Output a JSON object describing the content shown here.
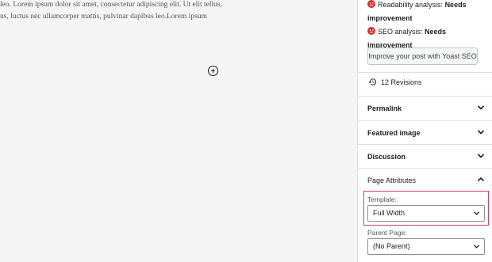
{
  "editor": {
    "paragraph_line_1": "leo. Lorem ipsum dolor sit amet, consectetur adipiscing elit. Ut elit tellus,",
    "paragraph_line_2": "us, luctus nec ullamcorper mattis, pulvinar dapibus leo.Lorem ipsum"
  },
  "sidebar": {
    "yoast": {
      "readability_label": "Readability analysis:",
      "readability_value_1": "Needs",
      "readability_value_2": "improvement",
      "seo_label": "SEO analysis:",
      "seo_value": "Needs improvement",
      "status_color": "#dc3232",
      "improve_button": "Improve your post with Yoast SEO"
    },
    "revisions": "12 Revisions",
    "panels": {
      "permalink": "Permalink",
      "featured_image": "Featured image",
      "discussion": "Discussion",
      "page_attributes": "Page Attributes"
    },
    "page_attributes": {
      "template_label": "Template:",
      "template_value": "Full Width",
      "parent_label": "Parent Page:",
      "parent_value": "(No Parent)"
    },
    "highlight_color": "#d63d63"
  }
}
